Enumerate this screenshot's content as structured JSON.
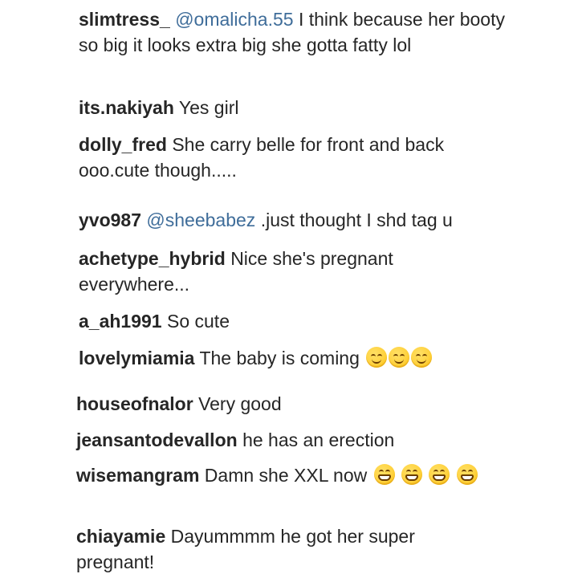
{
  "comments": [
    {
      "username": "slimtress_",
      "mention": "@omalicha.55",
      "text": "I think because her booty so big it looks extra big she gotta fatty lol"
    },
    {
      "username": "its.nakiyah",
      "text": "Yes girl"
    },
    {
      "username": "dolly_fred",
      "text": "She carry belle for front and back ooo.cute though....."
    },
    {
      "username": "yvo987",
      "mention": "@sheebabez",
      "text": ".just thought I shd tag u"
    },
    {
      "username": "achetype_hybrid",
      "text": "Nice she's pregnant everywhere..."
    },
    {
      "username": "a_ah1991",
      "text": "So cute"
    },
    {
      "username": "lovelymiamia",
      "text": "The baby is coming",
      "emojis": [
        "smiling-face-icon",
        "smiling-face-icon",
        "smiling-face-icon"
      ]
    },
    {
      "username": "houseofnalor",
      "text": "Very good"
    },
    {
      "username": "jeansantodevallon",
      "text": "he has an erection"
    },
    {
      "username": "wisemangram",
      "text": "Damn she XXL now",
      "emojis": [
        "grinning-face-icon",
        "grinning-face-icon",
        "grinning-face-icon",
        "grinning-face-icon"
      ]
    },
    {
      "username": "chiayamie",
      "text": "Dayummmm he got her super pregnant!"
    }
  ],
  "colors": {
    "text": "#262626",
    "mention": "#3f6d9a",
    "background": "#ffffff",
    "emoji": "#ffd23f"
  }
}
